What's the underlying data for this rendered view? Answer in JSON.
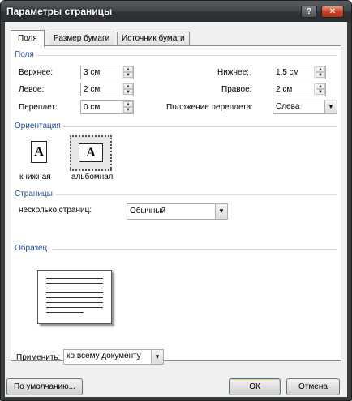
{
  "window": {
    "title": "Параметры страницы",
    "help_label": "?",
    "close_label": "✕"
  },
  "tabs": [
    {
      "label": "Поля"
    },
    {
      "label": "Размер бумаги"
    },
    {
      "label": "Источник бумаги"
    }
  ],
  "margins": {
    "section_label": "Поля",
    "top": {
      "label": "Верхнее:",
      "value": "3 см"
    },
    "bottom": {
      "label": "Нижнее:",
      "value": "1,5 см"
    },
    "left": {
      "label": "Левое:",
      "value": "2 см"
    },
    "right": {
      "label": "Правое:",
      "value": "2 см"
    },
    "gutter": {
      "label": "Переплет:",
      "value": "0 см"
    },
    "gutter_position": {
      "label": "Положение переплета:",
      "value": "Слева"
    }
  },
  "orientation": {
    "section_label": "Ориентация",
    "portrait": {
      "label": "книжная",
      "glyph": "A"
    },
    "landscape": {
      "label": "альбомная",
      "glyph": "A",
      "selected": true
    }
  },
  "pages": {
    "section_label": "Страницы",
    "multiple_label": "несколько страниц:",
    "multiple_value": "Обычный"
  },
  "preview": {
    "section_label": "Образец"
  },
  "apply": {
    "label": "Применить:",
    "value": "ко всему документу"
  },
  "buttons": {
    "default_label": "По умолчанию...",
    "ok_label": "ОК",
    "cancel_label": "Отмена"
  },
  "icons": {
    "spin_up": "▲",
    "spin_down": "▼",
    "dropdown": "▼"
  }
}
